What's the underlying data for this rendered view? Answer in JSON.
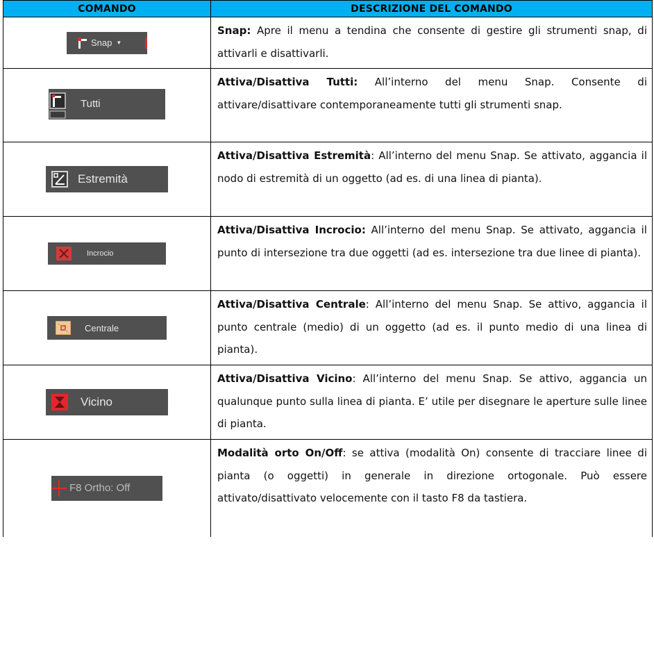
{
  "header": {
    "col_command": "COMANDO",
    "col_description": "DESCRIZIONE DEL COMANDO"
  },
  "rows": [
    {
      "button_label": "Snap",
      "button_icon": "snap-corner-icon",
      "name": "Snap:",
      "description": "Apre il menu a tendina che consente di gestire gli strumenti snap, di attivarli e disattivarli."
    },
    {
      "button_label": "Tutti",
      "button_icon": "snap-all-icon",
      "name": "Attiva/Disattiva Tutti:",
      "description": "All’interno del menu Snap. Consente di attivare/disattivare contemporaneamente tutti gli strumenti snap."
    },
    {
      "button_label": "Estremità",
      "button_icon": "endpoint-icon",
      "name": "Attiva/Disattiva Estremità",
      "description": ": All’interno del menu Snap. Se attivato, aggancia il nodo di estremità di un oggetto (ad es. di una linea di pianta)."
    },
    {
      "button_label": "Incrocio",
      "button_icon": "intersection-icon",
      "name": "Attiva/Disattiva Incrocio:",
      "description": "All’interno del menu Snap. Se attivato, aggancia il punto di intersezione tra due oggetti (ad es. intersezione tra due linee di pianta)."
    },
    {
      "button_label": "Centrale",
      "button_icon": "midpoint-icon",
      "name": "Attiva/Disattiva Centrale",
      "description": ":  All’interno del menu Snap. Se attivo, aggancia il punto centrale (medio) di un oggetto (ad es. il punto medio di una linea di pianta)."
    },
    {
      "button_label": "Vicino",
      "button_icon": "nearest-icon",
      "name": "Attiva/Disattiva Vicino",
      "description": ":  All’interno del menu Snap. Se attivo, aggancia un qualunque punto sulla linea di pianta. E’ utile per disegnare le aperture sulle linee di pianta."
    },
    {
      "button_label": "F8 Ortho: Off",
      "button_icon": "ortho-cross-icon",
      "name": "Modalità orto On/Off",
      "description": ": se attiva (modalità On) consente di tracciare linee di pianta (o oggetti) in generale in direzione ortogonale. Può essere attivato/disattivato velocemente con il tasto F8 da tastiera."
    }
  ],
  "colors": {
    "header_bg": "#00b0f0",
    "toolbar_bg": "#505050",
    "icon_red": "#e0282c"
  }
}
